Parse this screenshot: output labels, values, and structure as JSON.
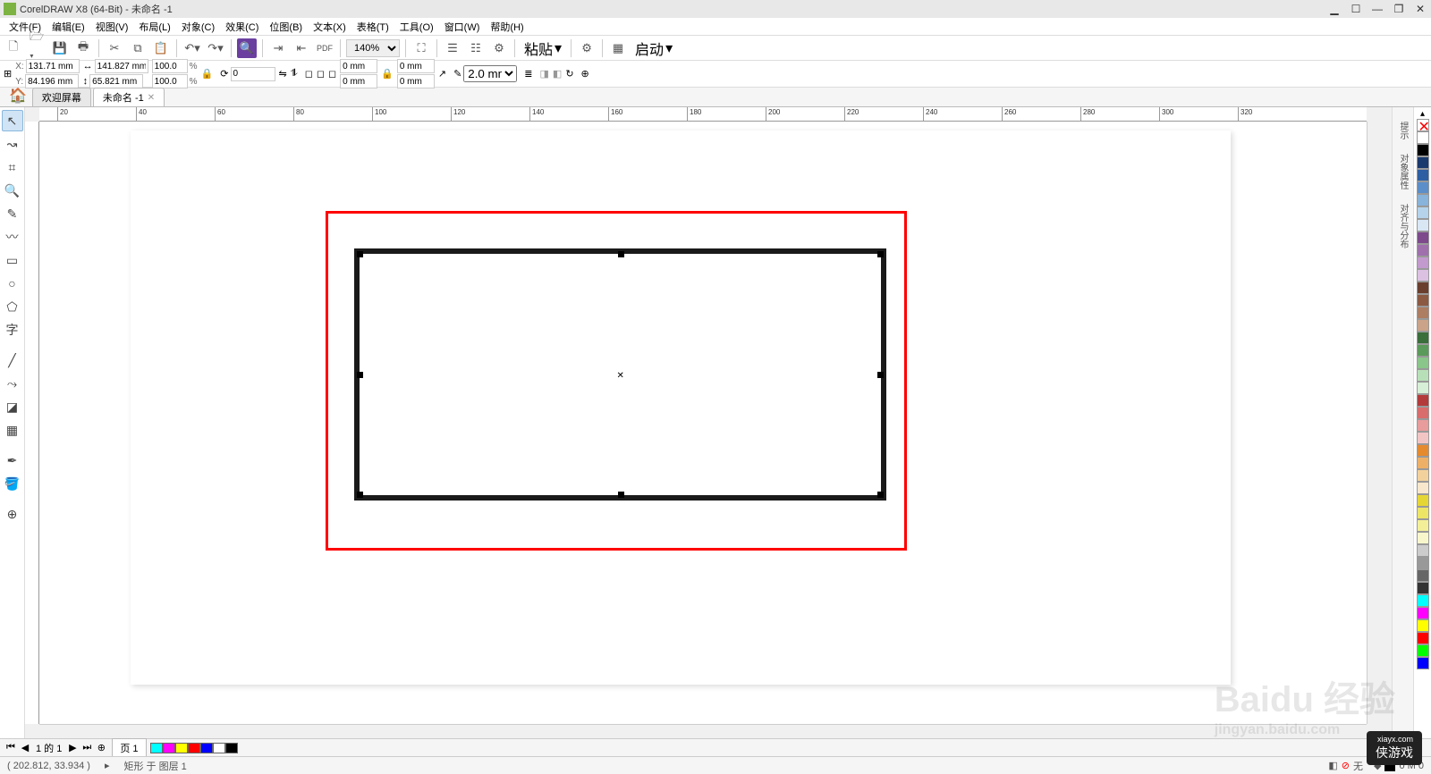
{
  "title": "CorelDRAW X8 (64-Bit) - 未命名 -1",
  "menus": [
    "文件(F)",
    "编辑(E)",
    "视图(V)",
    "布局(L)",
    "对象(C)",
    "效果(C)",
    "位图(B)",
    "文本(X)",
    "表格(T)",
    "工具(O)",
    "窗口(W)",
    "帮助(H)"
  ],
  "zoom": "140%",
  "toolbar_labels": {
    "paste": "粘贴",
    "launch": "启动"
  },
  "properties": {
    "x": "131.71 mm",
    "y": "84.196 mm",
    "w": "141.827 mm",
    "h": "65.821 mm",
    "sx": "100.0",
    "sy": "100.0",
    "rot": "0",
    "corner_top": "0 mm",
    "corner_bottom": "0 mm",
    "corner_right_top": "0 mm",
    "corner_right_bottom": "0 mm",
    "outline": "2.0 mm"
  },
  "tabs": {
    "welcome": "欢迎屏幕",
    "doc": "未命名 -1"
  },
  "ruler_ticks": [
    "20",
    "40",
    "60",
    "80",
    "100",
    "120",
    "140",
    "160",
    "180",
    "200",
    "220",
    "240",
    "260",
    "280",
    "300",
    "320"
  ],
  "dockers": [
    "提示",
    "对象属性",
    "对齐与分布"
  ],
  "palette_colors": [
    "#ffffff",
    "#000000",
    "#1a3a6e",
    "#2e5fa3",
    "#5c8ec9",
    "#88b3da",
    "#b5d3eb",
    "#d9e7f5",
    "#7e4a8c",
    "#a070ad",
    "#c29acd",
    "#dcc1e3",
    "#6b3f2e",
    "#8c5a43",
    "#ad7e62",
    "#cba388",
    "#3a6e3a",
    "#5a9a5a",
    "#8ac58a",
    "#b8e0b8",
    "#d6efd6",
    "#b33a3a",
    "#d96c6c",
    "#e89c9c",
    "#f2c5c5",
    "#e68a2e",
    "#edb066",
    "#f3d19c",
    "#f8e7cc",
    "#e6d633",
    "#ede566",
    "#f3ef99",
    "#f8f7cc",
    "#cccccc",
    "#999999",
    "#666666",
    "#333333",
    "#00ffff",
    "#ff00ff",
    "#ffff00",
    "#ff0000",
    "#00ff00",
    "#0000ff"
  ],
  "mini_palette": [
    "#00ffff",
    "#ff00ff",
    "#ffff00",
    "#ff0000",
    "#0000ff",
    "#ffffff",
    "#000000"
  ],
  "page_nav": {
    "counter": "1 的 1",
    "page_label": "页 1"
  },
  "status": {
    "coords": "( 202.812, 33.934 )",
    "obj": "矩形 于 图层 1",
    "fill_none": "无",
    "outline_info": "0 M 0"
  },
  "watermark": {
    "main": "Baidu 经验",
    "sub": "jingyan.baidu.com",
    "badge_site": "xiayx.com",
    "badge": "侠游戏"
  }
}
